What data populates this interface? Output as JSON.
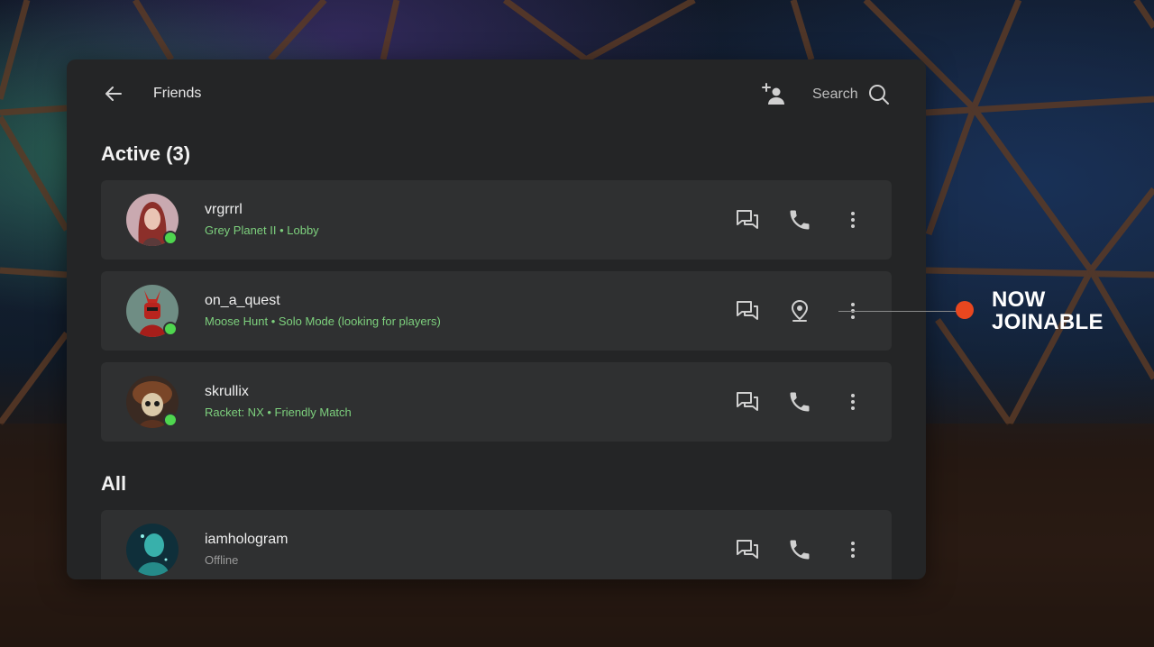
{
  "header": {
    "title": "Friends",
    "back_icon": "arrow-left-icon",
    "add_friend_icon": "person-add-icon",
    "search_label": "Search",
    "search_icon": "search-icon"
  },
  "sections": {
    "active_title": "Active (3)",
    "all_title": "All"
  },
  "friends": [
    {
      "name": "vrgrrrl",
      "status": "Grey Planet II • Lobby",
      "online": true,
      "secondary_action_icon": "phone-icon"
    },
    {
      "name": "on_a_quest",
      "status": "Moose Hunt • Solo Mode (looking for players)",
      "online": true,
      "secondary_action_icon": "location-pin-icon"
    },
    {
      "name": "skrullix",
      "status": "Racket: NX • Friendly Match",
      "online": true,
      "secondary_action_icon": "phone-icon"
    },
    {
      "name": "iamhologram",
      "status": "Offline",
      "online": false,
      "secondary_action_icon": "phone-icon"
    }
  ],
  "callout": {
    "line1": "NOW",
    "line2": "JOINABLE"
  },
  "colors": {
    "panel": "#242526",
    "row": "#2f3031",
    "online_status": "#7dd07d",
    "online_dot": "#4fd64f",
    "callout_dot": "#e8471f"
  }
}
